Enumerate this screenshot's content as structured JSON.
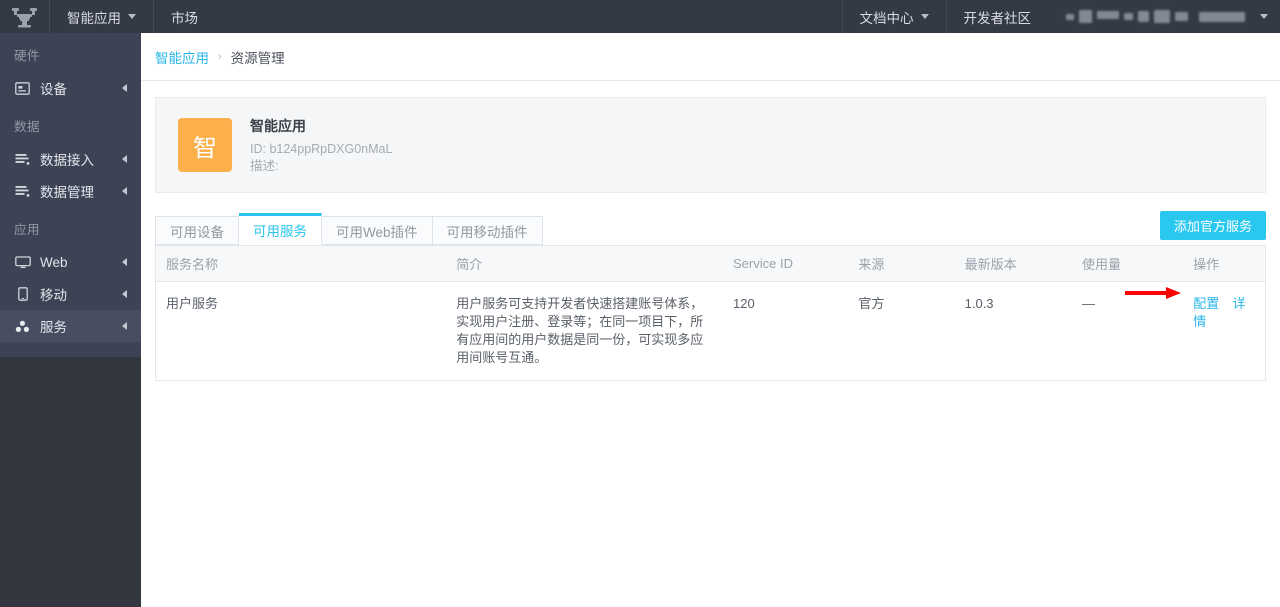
{
  "header": {
    "logo_icon": "brand-logo-icon",
    "left_nav": [
      {
        "label": "智能应用",
        "has_caret": true
      },
      {
        "label": "市场",
        "has_caret": false
      }
    ],
    "right_nav": [
      {
        "label": "文档中心",
        "has_caret": true
      },
      {
        "label": "开发者社区",
        "has_caret": false
      }
    ],
    "redacted_account": "",
    "account_caret_icon": "chevron-down-icon"
  },
  "sidebar": {
    "groups": [
      {
        "title": "硬件",
        "items": [
          {
            "label": "设备",
            "icon": "device-icon",
            "active": false
          }
        ]
      },
      {
        "title": "数据",
        "items": [
          {
            "label": "数据接入",
            "icon": "data-input-icon",
            "active": false
          },
          {
            "label": "数据管理",
            "icon": "data-manage-icon",
            "active": false
          }
        ]
      },
      {
        "title": "应用",
        "items": [
          {
            "label": "Web",
            "icon": "monitor-icon",
            "active": false
          },
          {
            "label": "移动",
            "icon": "mobile-icon",
            "active": false
          },
          {
            "label": "服务",
            "icon": "service-icon",
            "active": true
          }
        ]
      }
    ]
  },
  "breadcrumb": {
    "parent": "智能应用",
    "separator": "›",
    "current": "资源管理"
  },
  "app_card": {
    "avatar_text": "智",
    "name": "智能应用",
    "id_line": "ID: b124ppRpDXG0nMaL",
    "desc_line": "描述:"
  },
  "tabs": [
    {
      "label": "可用设备",
      "active": false
    },
    {
      "label": "可用服务",
      "active": true
    },
    {
      "label": "可用Web插件",
      "active": false
    },
    {
      "label": "可用移动插件",
      "active": false
    }
  ],
  "add_button_label": "添加官方服务",
  "table": {
    "columns": [
      "服务名称",
      "简介",
      "Service ID",
      "来源",
      "最新版本",
      "使用量",
      "操作"
    ],
    "rows": [
      {
        "name": "用户服务",
        "desc": "用户服务可支持开发者快速搭建账号体系，实现用户注册、登录等；在同一项目下，所有应用间的用户数据是同一份，可实现多应用间账号互通。",
        "service_id": "120",
        "source": "官方",
        "version": "1.0.3",
        "usage": "—",
        "actions": [
          "配置",
          "详情"
        ]
      }
    ]
  },
  "annotation": {
    "arrow_color": "#ff0000",
    "points_to": "配置"
  },
  "colors": {
    "accent": "#29c5ec",
    "header_bg": "#343a45",
    "sidebar_bg": "#3d4354",
    "avatar_orange": "#fbb04c"
  }
}
